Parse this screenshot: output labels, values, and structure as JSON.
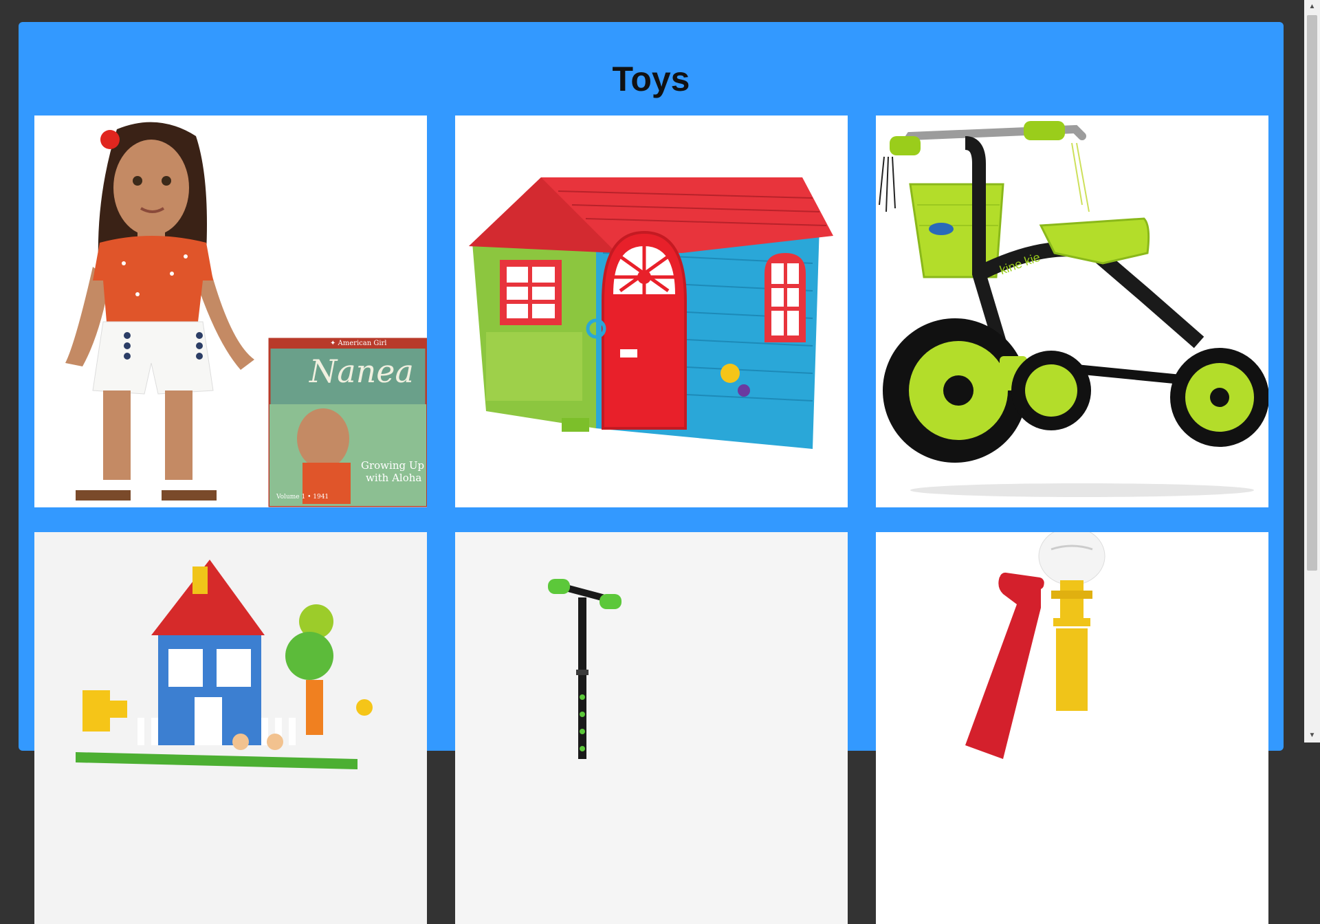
{
  "page": {
    "title": "Toys"
  },
  "products": [
    {
      "name": "doll-card",
      "image": "american-girl-doll-with-book",
      "book": {
        "brand": "✦ American Girl",
        "title": "Nanea",
        "subtitle1": "Growing Up",
        "subtitle2": "with Aloha",
        "footer": "Volume 1 • 1941"
      }
    },
    {
      "name": "playhouse-card",
      "image": "plastic-playhouse"
    },
    {
      "name": "tricycle-card",
      "image": "green-tricycle",
      "brand_label": "kine kie"
    },
    {
      "name": "blocks-card",
      "image": "building-blocks-house"
    },
    {
      "name": "scooter-card",
      "image": "kick-scooter"
    },
    {
      "name": "tball-card",
      "image": "t-ball-set"
    }
  ],
  "colors": {
    "background": "#333333",
    "panel": "#3399ff",
    "card": "#ffffff"
  }
}
